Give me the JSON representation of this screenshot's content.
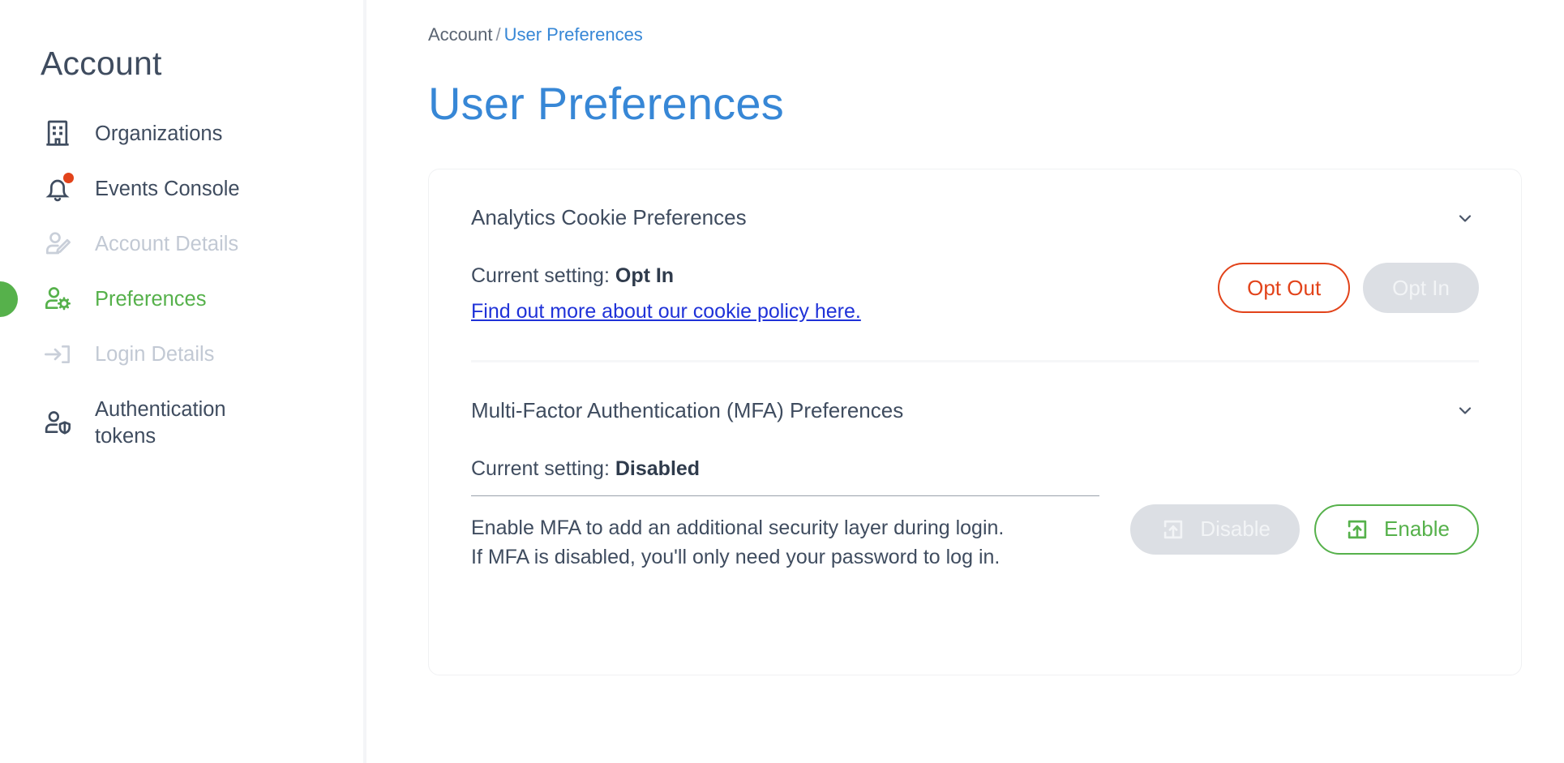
{
  "sidebar": {
    "title": "Account",
    "items": [
      {
        "label": "Organizations",
        "icon": "building-icon",
        "state": "normal",
        "badge": false
      },
      {
        "label": "Events Console",
        "icon": "bell-icon",
        "state": "normal",
        "badge": true
      },
      {
        "label": "Account Details",
        "icon": "user-edit-icon",
        "state": "disabled",
        "badge": false
      },
      {
        "label": "Preferences",
        "icon": "user-gear-icon",
        "state": "active",
        "badge": false
      },
      {
        "label": "Login Details",
        "icon": "login-arrow-icon",
        "state": "disabled",
        "badge": false
      },
      {
        "label": "Authentication tokens",
        "icon": "user-shield-icon",
        "state": "normal",
        "badge": false
      }
    ]
  },
  "breadcrumb": {
    "root": "Account",
    "separator": "/",
    "current": "User Preferences"
  },
  "page": {
    "title": "User Preferences"
  },
  "cookies": {
    "section_title": "Analytics Cookie Preferences",
    "current_label": "Current setting:",
    "current_value": "Opt In",
    "policy_link": "Find out more about our cookie policy here.",
    "opt_out_label": "Opt Out",
    "opt_in_label": "Opt In",
    "chevron": "chevron-down-icon"
  },
  "mfa": {
    "section_title": "Multi-Factor Authentication (MFA) Preferences",
    "current_label": "Current setting:",
    "current_value": "Disabled",
    "description_line1": "Enable MFA to add an additional security layer during login.",
    "description_line2": "If MFA is disabled, you'll only need your password to log in.",
    "disable_label": "Disable",
    "enable_label": "Enable",
    "chevron": "chevron-down-icon"
  },
  "colors": {
    "brand_green": "#56b14b",
    "link_blue": "#3787d6",
    "title_blue": "#3787d6",
    "danger_red": "#e2431a",
    "text_slate": "#3f4c5f",
    "disabled_gray": "#c2c9d4",
    "policy_link_blue": "#1f32d8"
  }
}
